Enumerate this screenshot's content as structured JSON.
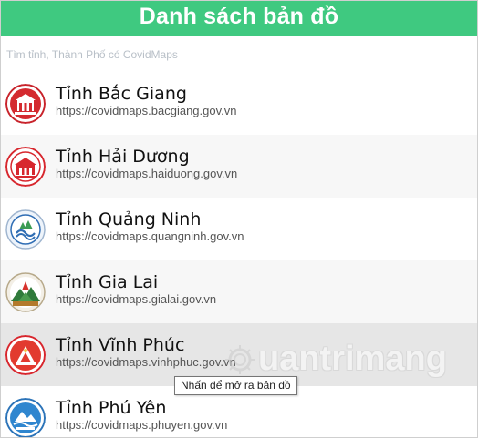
{
  "header": {
    "title": "Danh sách bản đồ"
  },
  "search": {
    "placeholder": "Tìm tỉnh, Thành Phố có CovidMaps",
    "value": ""
  },
  "items": [
    {
      "name": "Tỉnh Bắc Giang",
      "url": "https://covidmaps.bacgiang.gov.vn",
      "logo": "bac-giang-emblem-icon"
    },
    {
      "name": "Tỉnh Hải Dương",
      "url": "https://covidmaps.haiduong.gov.vn",
      "logo": "hai-duong-emblem-icon"
    },
    {
      "name": "Tỉnh Quảng Ninh",
      "url": "https://covidmaps.quangninh.gov.vn",
      "logo": "quang-ninh-emblem-icon"
    },
    {
      "name": "Tỉnh Gia Lai",
      "url": "https://covidmaps.gialai.gov.vn",
      "logo": "gia-lai-emblem-icon"
    },
    {
      "name": "Tỉnh Vĩnh Phúc",
      "url": "https://covidmaps.vinhphuc.gov.vn",
      "logo": "vinh-phuc-emblem-icon"
    },
    {
      "name": "Tỉnh Phú Yên",
      "url": "https://covidmaps.phuyen.gov.vn",
      "logo": "phu-yen-emblem-icon"
    }
  ],
  "tooltip": {
    "text": "Nhấn để mở ra bản đồ"
  },
  "watermark": {
    "text": "uantrimang",
    "icon": "quantrimang-logo-icon"
  },
  "colors": {
    "header_bg": "#3fc980",
    "row_alt": "#f7f7f7",
    "row_hover": "#e6e6e6"
  }
}
